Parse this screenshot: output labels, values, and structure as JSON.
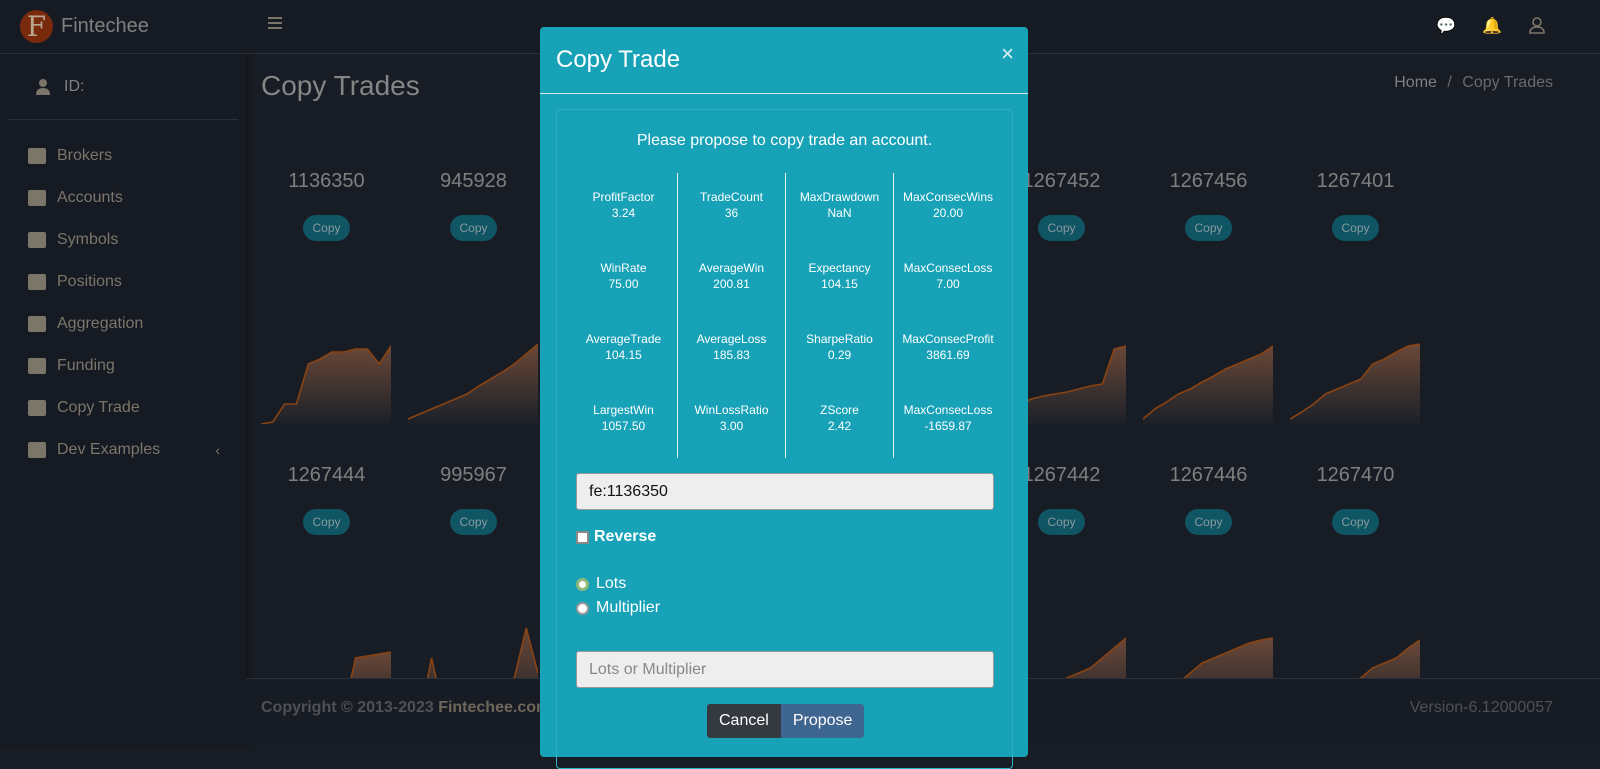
{
  "brand": {
    "name": "Fintechee",
    "logo_letter": "F"
  },
  "user": {
    "label": "ID:"
  },
  "sidebar": {
    "items": [
      {
        "label": "Brokers",
        "icon": "bank-icon"
      },
      {
        "label": "Accounts",
        "icon": "address-book-icon"
      },
      {
        "label": "Symbols",
        "icon": "chart-line-icon"
      },
      {
        "label": "Positions",
        "icon": "box-open-icon"
      },
      {
        "label": "Aggregation",
        "icon": "boxes-icon"
      },
      {
        "label": "Funding",
        "icon": "money-bill-icon"
      },
      {
        "label": "Copy Trade",
        "icon": "copy-icon"
      },
      {
        "label": "Dev Examples",
        "icon": "folder-open-icon",
        "chevron": "‹"
      }
    ]
  },
  "header": {
    "title": "Copy Trades",
    "breadcrumb": [
      "Home",
      "/",
      "Copy Trades"
    ]
  },
  "cards": {
    "copy_label": "Copy",
    "row1": [
      "1136350",
      "945928",
      "1267452",
      "1267456",
      "1267401"
    ],
    "row2": [
      "1267444",
      "995967",
      "1267442",
      "1267446",
      "1267470"
    ]
  },
  "footer": {
    "copyright": "Copyright © 2013-2023 ",
    "company": "Fintechee.com",
    "version": "Version-6.12000057"
  },
  "modal": {
    "title": "Copy Trade",
    "close": "×",
    "intro": "Please propose to copy trade an account.",
    "stats": [
      [
        {
          "k": "ProfitFactor",
          "v": "3.24"
        },
        {
          "k": "WinRate",
          "v": "75.00"
        },
        {
          "k": "AverageTrade",
          "v": "104.15"
        },
        {
          "k": "LargestWin",
          "v": "1057.50"
        }
      ],
      [
        {
          "k": "TradeCount",
          "v": "36"
        },
        {
          "k": "AverageWin",
          "v": "200.81"
        },
        {
          "k": "AverageLoss",
          "v": "185.83"
        },
        {
          "k": "WinLossRatio",
          "v": "3.00"
        }
      ],
      [
        {
          "k": "MaxDrawdown",
          "v": "NaN"
        },
        {
          "k": "Expectancy",
          "v": "104.15"
        },
        {
          "k": "SharpeRatio",
          "v": "0.29"
        },
        {
          "k": "ZScore",
          "v": "2.42"
        }
      ],
      [
        {
          "k": "MaxConsecWins",
          "v": "20.00"
        },
        {
          "k": "MaxConsecLoss",
          "v": "7.00"
        },
        {
          "k": "MaxConsecProfit",
          "v": "3861.69"
        },
        {
          "k": "MaxConsecLoss",
          "v": "-1659.87"
        }
      ]
    ],
    "account_value": "fe:1136350",
    "reverse_label": "Reverse",
    "reverse_checked": false,
    "radio": {
      "lots": "Lots",
      "multiplier": "Multiplier",
      "selected": "Lots"
    },
    "amount_placeholder": "Lots or Multiplier",
    "cancel": "Cancel",
    "propose": "Propose",
    "accent": "#17a2b8"
  }
}
